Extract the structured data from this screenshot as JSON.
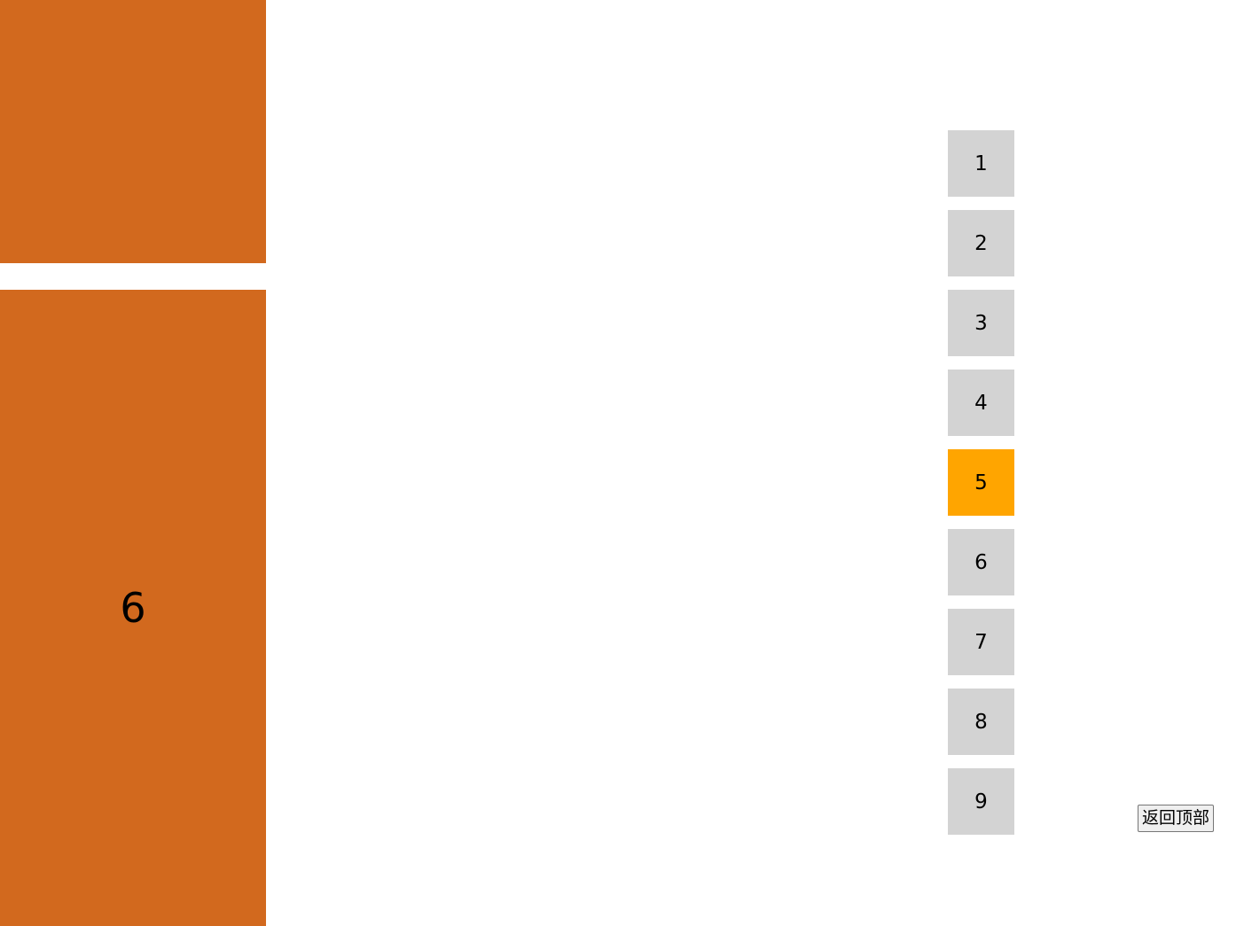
{
  "colors": {
    "panel": "#d2691e",
    "nav_default": "#d3d3d3",
    "nav_active": "#ffa500"
  },
  "panels": {
    "top": {
      "label": ""
    },
    "main": {
      "label": "6"
    }
  },
  "nav": {
    "active_index": 4,
    "items": [
      {
        "label": "1"
      },
      {
        "label": "2"
      },
      {
        "label": "3"
      },
      {
        "label": "4"
      },
      {
        "label": "5"
      },
      {
        "label": "6"
      },
      {
        "label": "7"
      },
      {
        "label": "8"
      },
      {
        "label": "9"
      }
    ]
  },
  "back_to_top": {
    "label": "返回顶部"
  }
}
